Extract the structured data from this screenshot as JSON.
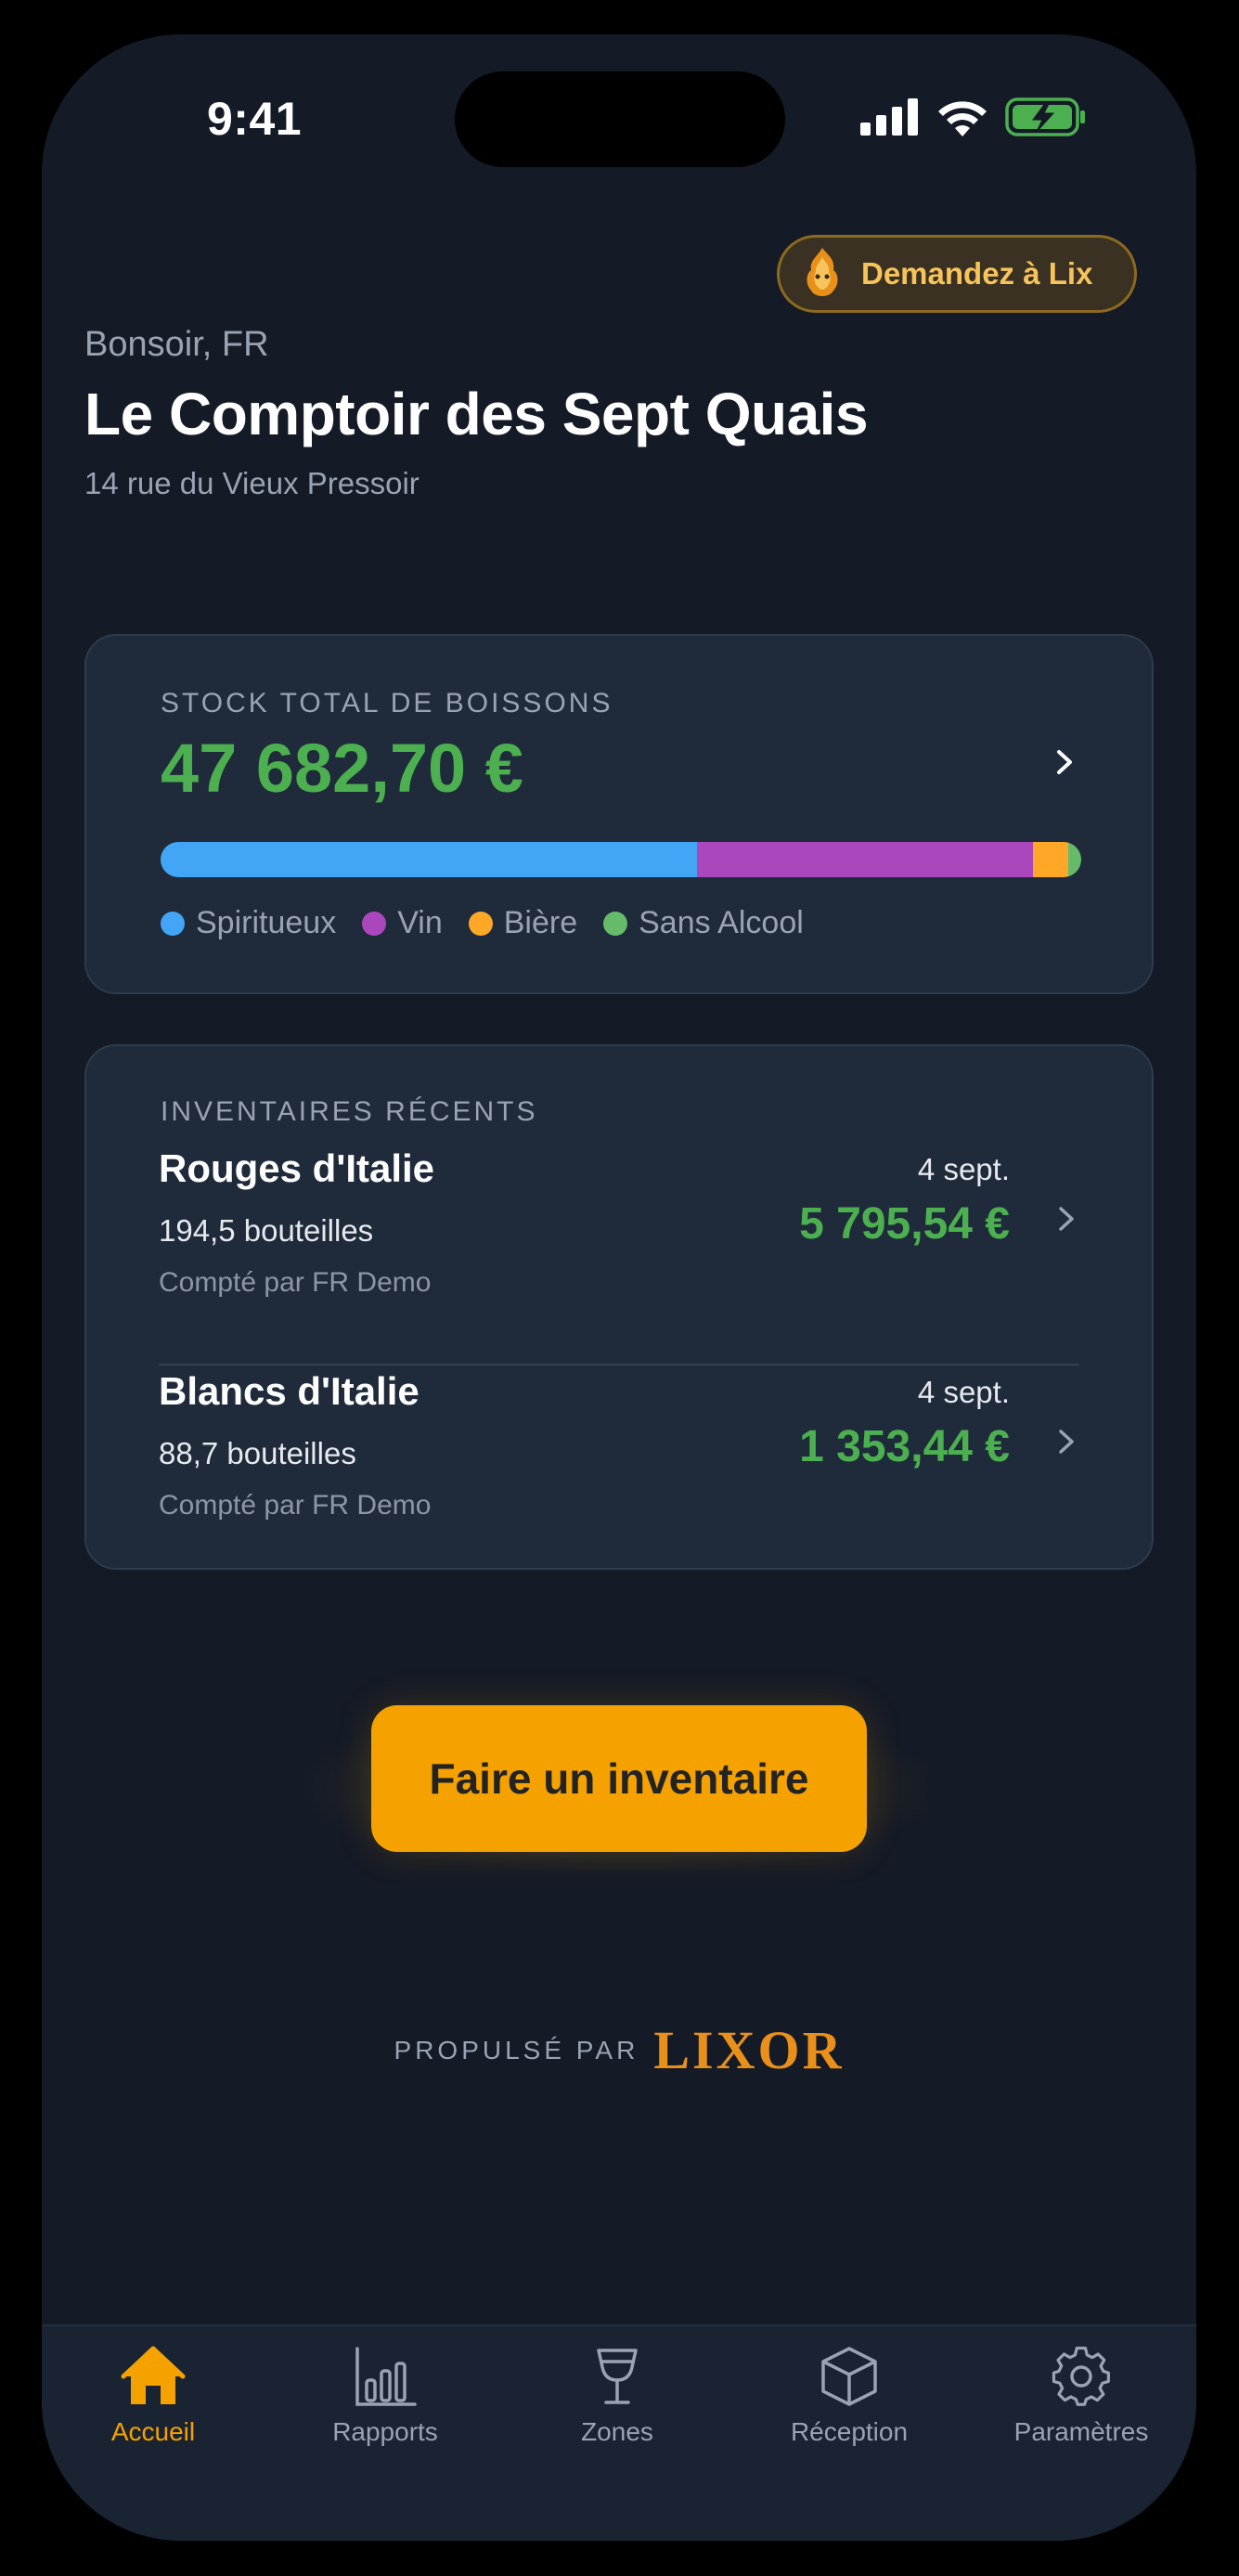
{
  "status_bar": {
    "time": "9:41"
  },
  "header": {
    "assistant_button_label": "Demandez à Lix",
    "greeting": "Bonsoir, FR",
    "venue_name": "Le Comptoir des Sept Quais",
    "venue_address": "14 rue du Vieux Pressoir"
  },
  "stock": {
    "label": "STOCK TOTAL DE BOISSONS",
    "value": "47 682,70 €",
    "breakdown": [
      {
        "name": "Spiritueux",
        "fraction": 0.583,
        "color": "#42a5f5"
      },
      {
        "name": "Vin",
        "fraction": 0.365,
        "color": "#ab47bc"
      },
      {
        "name": "Bière",
        "fraction": 0.038,
        "color": "#ffa726"
      },
      {
        "name": "Sans Alcool",
        "fraction": 0.014,
        "color": "#66bb6a"
      }
    ]
  },
  "recent": {
    "label": "INVENTAIRES RÉCENTS",
    "items": [
      {
        "name": "Rouges d'Italie",
        "count": "194,5 bouteilles",
        "counted_by": "Compté par FR Demo",
        "date": "4 sept.",
        "value": "5 795,54 €"
      },
      {
        "name": "Blancs d'Italie",
        "count": "88,7 bouteilles",
        "counted_by": "Compté par FR Demo",
        "date": "4 sept.",
        "value": "1 353,44 €"
      }
    ]
  },
  "cta": {
    "label": "Faire un inventaire"
  },
  "powered_by": {
    "label": "PROPULSÉ PAR",
    "brand": "LIXOR"
  },
  "tabs": [
    {
      "label": "Accueil",
      "icon": "home-icon",
      "active": true
    },
    {
      "label": "Rapports",
      "icon": "bar-chart-icon",
      "active": false
    },
    {
      "label": "Zones",
      "icon": "wine-glass-icon",
      "active": false
    },
    {
      "label": "Réception",
      "icon": "box-icon",
      "active": false
    },
    {
      "label": "Paramètres",
      "icon": "gear-icon",
      "active": false
    }
  ],
  "colors": {
    "background": "#141a26",
    "card": "#1f2b3b",
    "accent": "#f5a200",
    "positive": "#4caf50",
    "muted_text": "#9aa3b2"
  }
}
